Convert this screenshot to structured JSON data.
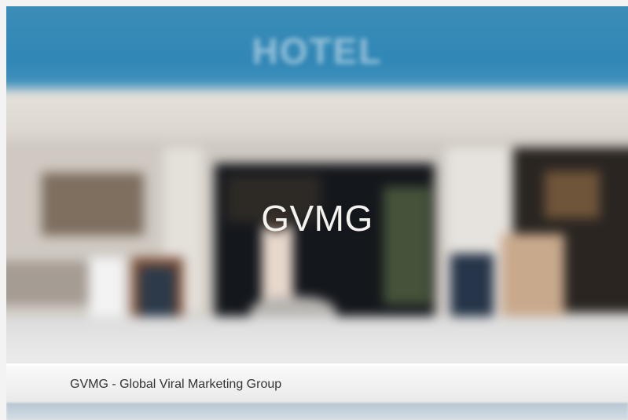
{
  "hero": {
    "sign_text": "HOTEL",
    "title": "GVMG"
  },
  "caption": {
    "text": "GVMG - Global Viral Marketing Group"
  },
  "colors": {
    "sky_blue": "#2f86b5",
    "caption_background": "#f0f0f0",
    "caption_text": "#333333",
    "title_text": "#f4f2ef"
  }
}
